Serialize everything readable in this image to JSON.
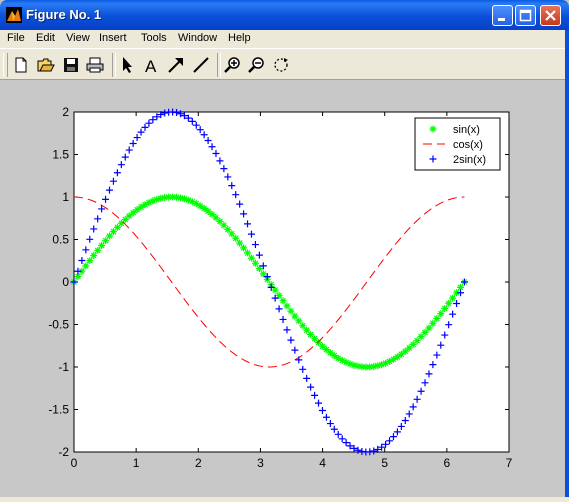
{
  "window": {
    "title": "Figure No. 1"
  },
  "menu": [
    "File",
    "Edit",
    "View",
    "Insert",
    "Tools",
    "Window",
    "Help"
  ],
  "toolbar_icons": [
    "new-file-icon",
    "open-folder-icon",
    "save-icon",
    "print-icon",
    "arrow-select-icon",
    "text-insert-icon",
    "arrow-insert-icon",
    "line-insert-icon",
    "zoom-in-icon",
    "zoom-out-icon",
    "rotate-3d-icon"
  ],
  "colors": {
    "sin": "#00ff00",
    "cos": "#ff0000",
    "twosin": "#0000ff",
    "figure_bg": "#c8c8c8"
  },
  "chart_data": {
    "type": "line",
    "xlim": [
      0,
      7
    ],
    "ylim": [
      -2,
      2
    ],
    "xticks": [
      "0",
      "1",
      "2",
      "3",
      "4",
      "5",
      "6",
      "7"
    ],
    "yticks": [
      "-2",
      "-1.5",
      "-1",
      "-0.5",
      "0",
      "0.5",
      "1",
      "1.5",
      "2"
    ],
    "legend_position": "top-right",
    "grid": false,
    "x_range": [
      0,
      6.2832
    ],
    "num_points": 100,
    "series": [
      {
        "name": "sin(x)",
        "marker": "*",
        "linestyle": "none",
        "color": "#00ff00",
        "function": "sin(x)"
      },
      {
        "name": "cos(x)",
        "marker": "none",
        "linestyle": "dashed",
        "color": "#ff0000",
        "function": "cos(x)"
      },
      {
        "name": "2sin(x)",
        "marker": "+",
        "linestyle": "none",
        "color": "#0000ff",
        "function": "2*sin(x)"
      }
    ]
  }
}
